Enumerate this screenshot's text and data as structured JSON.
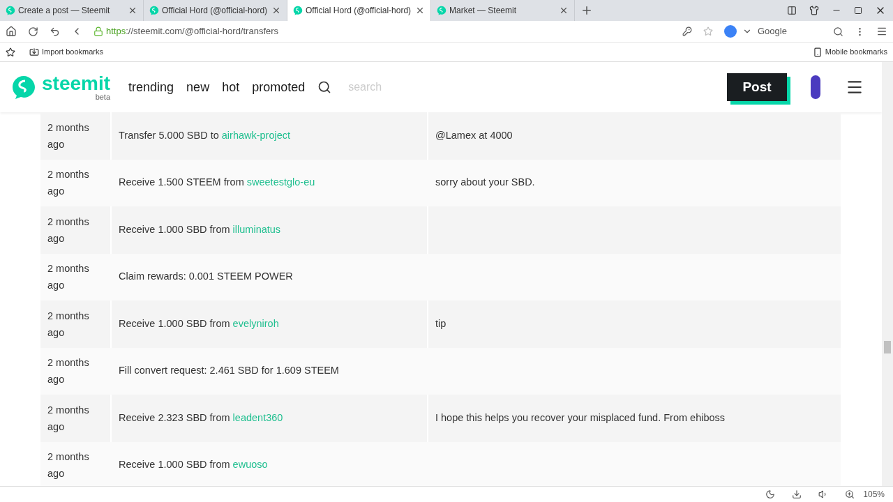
{
  "tabs": [
    {
      "title": "Create a post — Steemit",
      "selected": false
    },
    {
      "title": "Official Hord (@official-hord)",
      "selected": false
    },
    {
      "title": "Official Hord (@official-hord)",
      "selected": true
    },
    {
      "title": "Market — Steemit",
      "selected": false
    }
  ],
  "address": {
    "scheme": "https",
    "rest": "://steemit.com/@official-hord/transfers"
  },
  "search_engine": "Google",
  "bookmarks": {
    "import": "Import bookmarks",
    "mobile": "Mobile bookmarks"
  },
  "site": {
    "logo": "steemit",
    "badge": "beta",
    "nav": [
      "trending",
      "new",
      "hot",
      "promoted"
    ],
    "search_placeholder": "search",
    "post_button": "Post"
  },
  "rows": [
    {
      "date": "2 months ago",
      "text": "Transfer 5.000 SBD to",
      "link": "airhawk-project",
      "memo": "@Lamex at 4000"
    },
    {
      "date": "2 months ago",
      "text": "Receive 1.500 STEEM from",
      "link": "sweetestglo-eu",
      "memo": "sorry about your SBD."
    },
    {
      "date": "2 months ago",
      "text": "Receive 1.000 SBD from",
      "link": "illuminatus",
      "memo": ""
    },
    {
      "date": "2 months ago",
      "text": "Claim rewards: 0.001 STEEM POWER",
      "link": "",
      "memo": ""
    },
    {
      "date": "2 months ago",
      "text": "Receive 1.000 SBD from",
      "link": "evelyniroh",
      "memo": "tip"
    },
    {
      "date": "2 months ago",
      "text": "Fill convert request: 2.461 SBD for 1.609 STEEM",
      "link": "",
      "memo": ""
    },
    {
      "date": "2 months ago",
      "text": "Receive 2.323 SBD from",
      "link": "leadent360",
      "memo": "I hope this helps you recover your misplaced fund. From ehiboss"
    },
    {
      "date": "2 months ago",
      "text": "Receive 1.000 SBD from",
      "link": "ewuoso",
      "memo": ""
    }
  ],
  "zoom": "105%"
}
